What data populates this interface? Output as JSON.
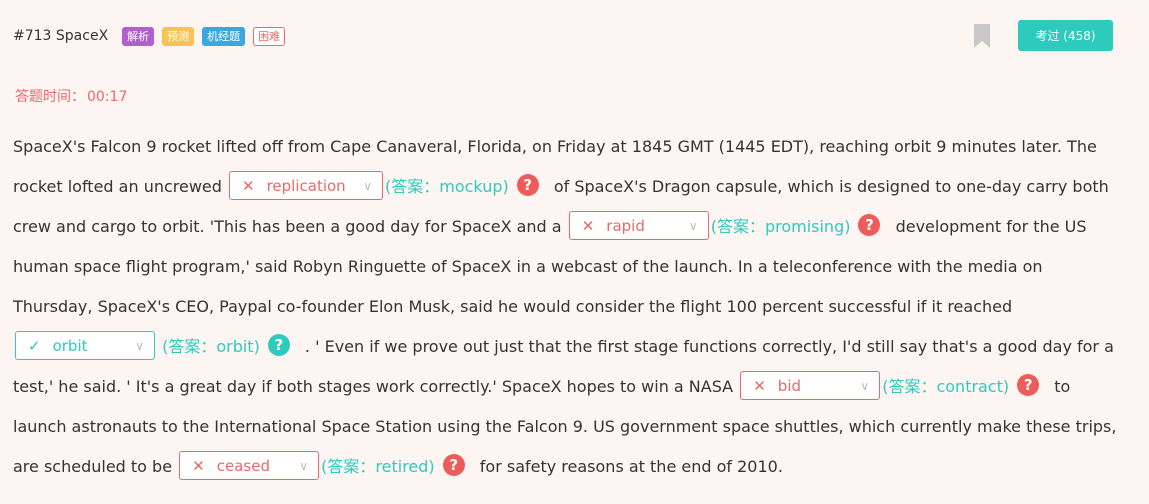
{
  "header": {
    "question_id": "#713 SpaceX",
    "tags": [
      "解析",
      "预测",
      "机经题",
      "困难"
    ],
    "done_button": "考过 (458)"
  },
  "timer": {
    "label": "答题时间：",
    "value": "00:17"
  },
  "passage": {
    "t0": "SpaceX's Falcon 9 rocket lifted off from Cape Canaveral, Florida, on Friday at 1845 GMT (1445 EDT), reaching orbit 9 minutes later. The rocket lofted an uncrewed",
    "t1": "of SpaceX's Dragon capsule, which is designed to one-day carry both crew and cargo to orbit. 'This has been a good day for SpaceX and a",
    "t2": "development for the US human space flight program,' said Robyn Ringuette of SpaceX in a webcast of the launch. In a teleconference with the media on Thursday, SpaceX's CEO, Paypal co-founder Elon Musk, said he would consider the flight 100 percent successful if it reached",
    "t3": ". ' Even if we prove out just that the first stage functions correctly, I'd still say that's a good day for a test,' he said. ' It's a great day if both stages work correctly.' SpaceX hopes to win a NASA",
    "t4": "to launch astronauts to the International Space Station using the Falcon 9. US government space shuttles, which currently make these trips, are scheduled to be",
    "t5": "for safety reasons at the end of 2010."
  },
  "blanks": [
    {
      "selected": "replication",
      "answer": "(答案：mockup)",
      "correct": false
    },
    {
      "selected": "rapid",
      "answer": "(答案：promising)",
      "correct": false
    },
    {
      "selected": "orbit",
      "answer": "(答案：orbit)",
      "correct": true
    },
    {
      "selected": "bid",
      "answer": "(答案：contract)",
      "correct": false
    },
    {
      "selected": "ceased",
      "answer": "(答案：retired)",
      "correct": false
    }
  ],
  "icons": {
    "wrong": "✕",
    "right": "✓",
    "chevron": "∨",
    "help": "?"
  },
  "colors": {
    "background": "#fdf5f2",
    "accent": "#2dcbbd",
    "error": "#ea6a6a"
  }
}
